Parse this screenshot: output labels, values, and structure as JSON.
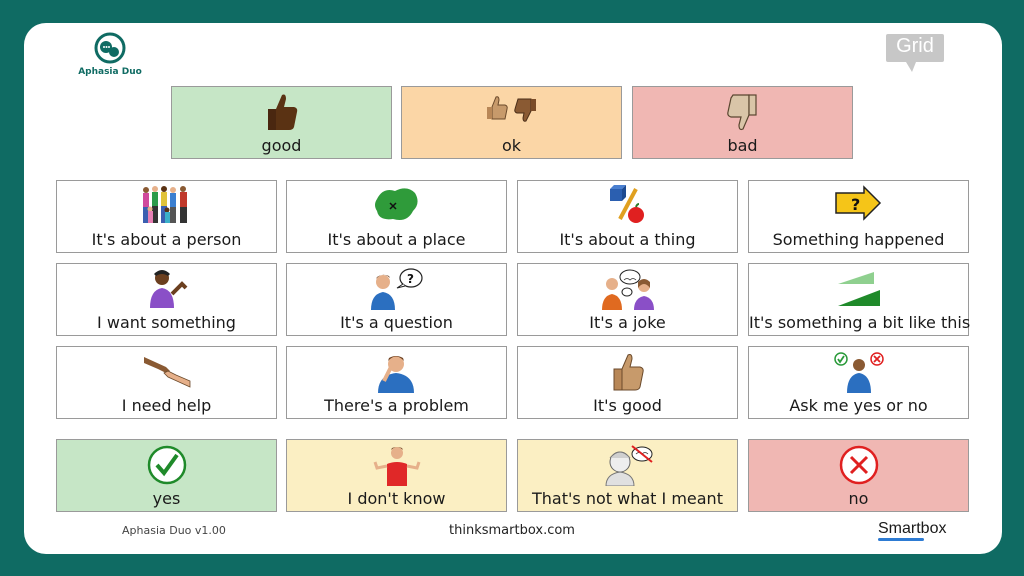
{
  "app": {
    "logo_text": "Aphasia Duo",
    "grid_badge": "Grid"
  },
  "top_row": [
    {
      "label": "good",
      "icon": "thumbs-up-icon"
    },
    {
      "label": "ok",
      "icon": "thumbs-up-down-icon"
    },
    {
      "label": "bad",
      "icon": "thumbs-down-icon"
    }
  ],
  "grid": [
    {
      "label": "It's about a person",
      "icon": "people-group-icon"
    },
    {
      "label": "It's about a place",
      "icon": "map-place-icon"
    },
    {
      "label": "It's about a thing",
      "icon": "objects-icon"
    },
    {
      "label": "Something happened",
      "icon": "question-arrow-icon"
    },
    {
      "label": "I want something",
      "icon": "person-wanting-icon"
    },
    {
      "label": "It's a question",
      "icon": "person-question-icon"
    },
    {
      "label": "It's a joke",
      "icon": "people-joke-icon"
    },
    {
      "label": "It's something a bit like this",
      "icon": "similar-shapes-icon"
    },
    {
      "label": "I need help",
      "icon": "helping-hands-icon"
    },
    {
      "label": "There's a problem",
      "icon": "person-problem-icon"
    },
    {
      "label": "It's good",
      "icon": "thumbs-up-icon"
    },
    {
      "label": "Ask me yes or no",
      "icon": "person-yes-no-icon"
    }
  ],
  "bottom_row": [
    {
      "label": "yes",
      "icon": "check-circle-icon"
    },
    {
      "label": "I don't know",
      "icon": "person-shrug-icon"
    },
    {
      "label": "That's not what I meant",
      "icon": "person-not-meant-icon"
    },
    {
      "label": "no",
      "icon": "x-circle-icon"
    }
  ],
  "footer": {
    "version": "Aphasia Duo v1.00",
    "website": "thinksmartbox.com",
    "brand": "Smartbox"
  },
  "colors": {
    "frame": "#0f6b63",
    "good": "#c6e6c6",
    "ok": "#fbd6a6",
    "bad": "#f0b7b3",
    "unsure": "#fbefc3"
  }
}
